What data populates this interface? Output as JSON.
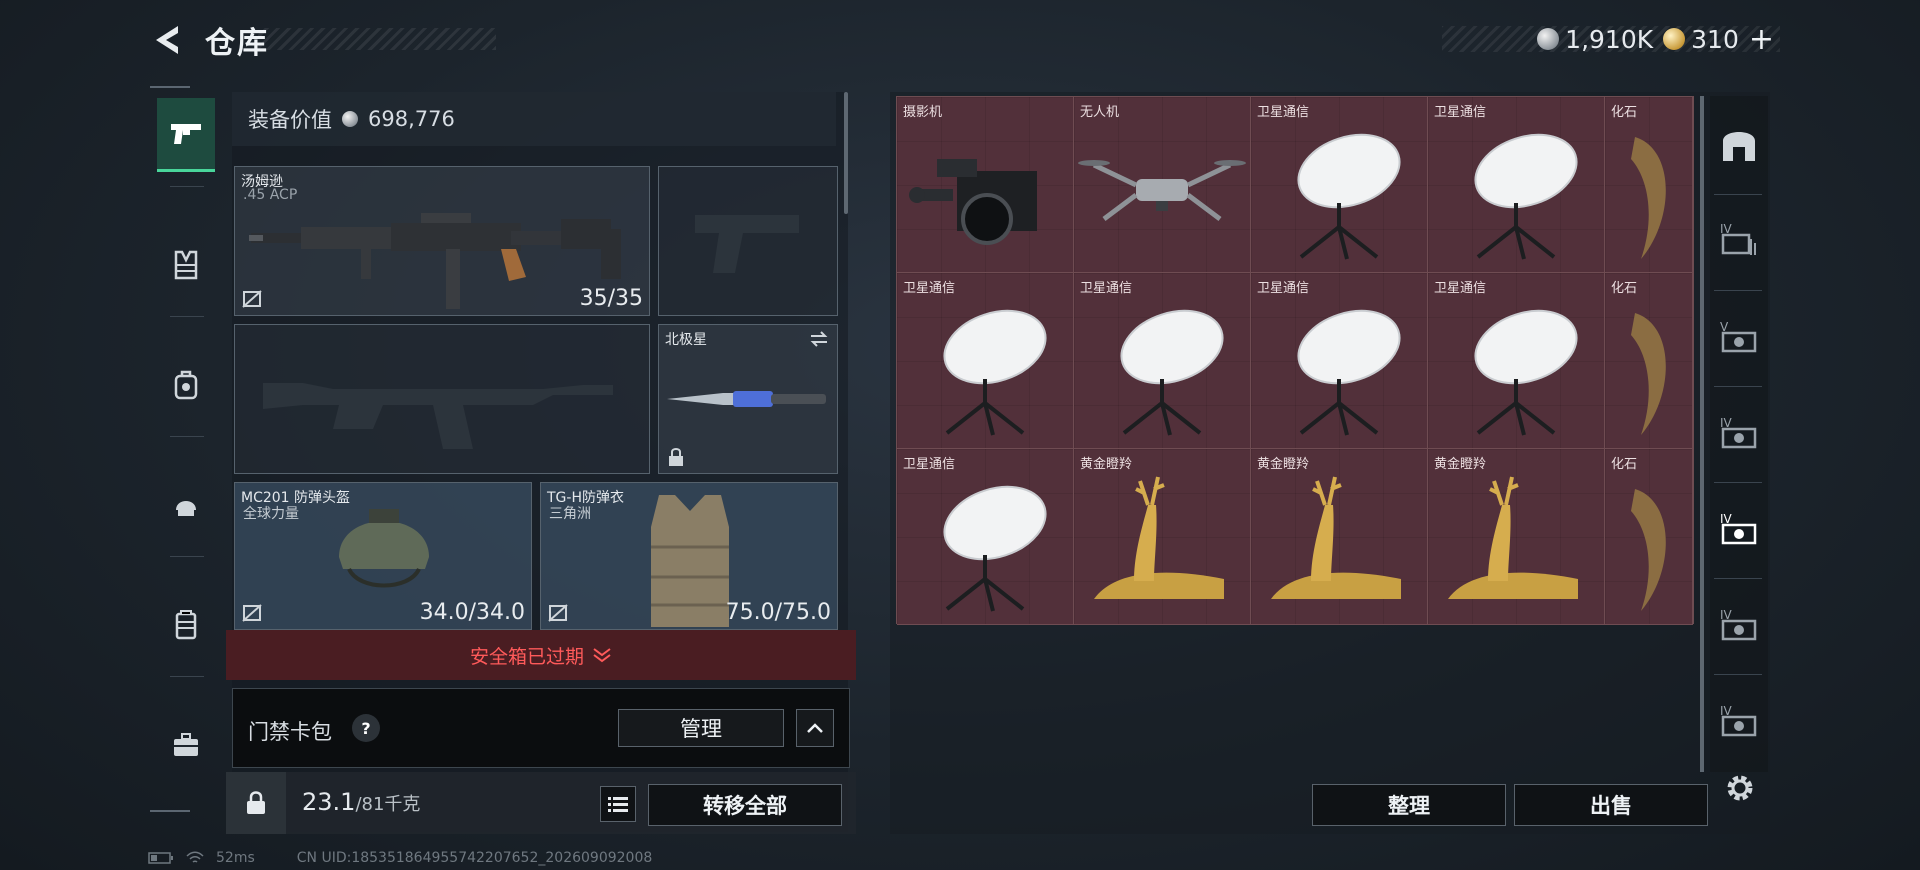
{
  "header": {
    "title": "仓库",
    "currency_silver": "1,910K",
    "currency_gold": "310",
    "plus": "+"
  },
  "equipment": {
    "value_label": "装备价值",
    "value": "698,776",
    "primary": {
      "name": "汤姆逊",
      "ammo": ".45 ACP",
      "durability": "35/35"
    },
    "melee": {
      "name": "北极星"
    },
    "helmet": {
      "name": "MC201 防弹头盔",
      "brand": "全球力量",
      "durability": "34.0/34.0"
    },
    "armor": {
      "name": "TG-H防弹衣",
      "brand": "三角洲",
      "durability": "75.0/75.0"
    }
  },
  "safe_box": {
    "label": "安全箱已过期"
  },
  "card_bag": {
    "label": "门禁卡包",
    "help": "?",
    "manage": "管理"
  },
  "bottom": {
    "weight": "23.1",
    "weight_max": "/81千克",
    "transfer_all": "转移全部"
  },
  "storage": {
    "items": [
      {
        "name": "摄影机",
        "icon": "camera-icon"
      },
      {
        "name": "无人机",
        "icon": "drone-icon"
      },
      {
        "name": "卫星通信",
        "icon": "satellite-dish-icon"
      },
      {
        "name": "卫星通信",
        "icon": "satellite-dish-icon"
      },
      {
        "name": "化石",
        "icon": "fossil-claw-icon"
      },
      {
        "name": "卫星通信",
        "icon": "satellite-dish-icon"
      },
      {
        "name": "卫星通信",
        "icon": "satellite-dish-icon"
      },
      {
        "name": "卫星通信",
        "icon": "satellite-dish-icon"
      },
      {
        "name": "卫星通信",
        "icon": "satellite-dish-icon"
      },
      {
        "name": "化石",
        "icon": "fossil-claw-icon"
      },
      {
        "name": "卫星通信",
        "icon": "satellite-dish-icon"
      },
      {
        "name": "黄金瞪羚",
        "icon": "golden-gazelle-icon"
      },
      {
        "name": "黄金瞪羚",
        "icon": "golden-gazelle-icon"
      },
      {
        "name": "黄金瞪羚",
        "icon": "golden-gazelle-icon"
      },
      {
        "name": "化石",
        "icon": "fossil-claw-icon"
      }
    ],
    "sort": "整理",
    "sell": "出售"
  },
  "status": {
    "ping": "52ms",
    "uid": "CN UID:1853518649557422076​52_202609092008"
  },
  "colors": {
    "accent": "#49d69b",
    "warning": "#ff5a5a",
    "item_bg": "#52303a"
  }
}
